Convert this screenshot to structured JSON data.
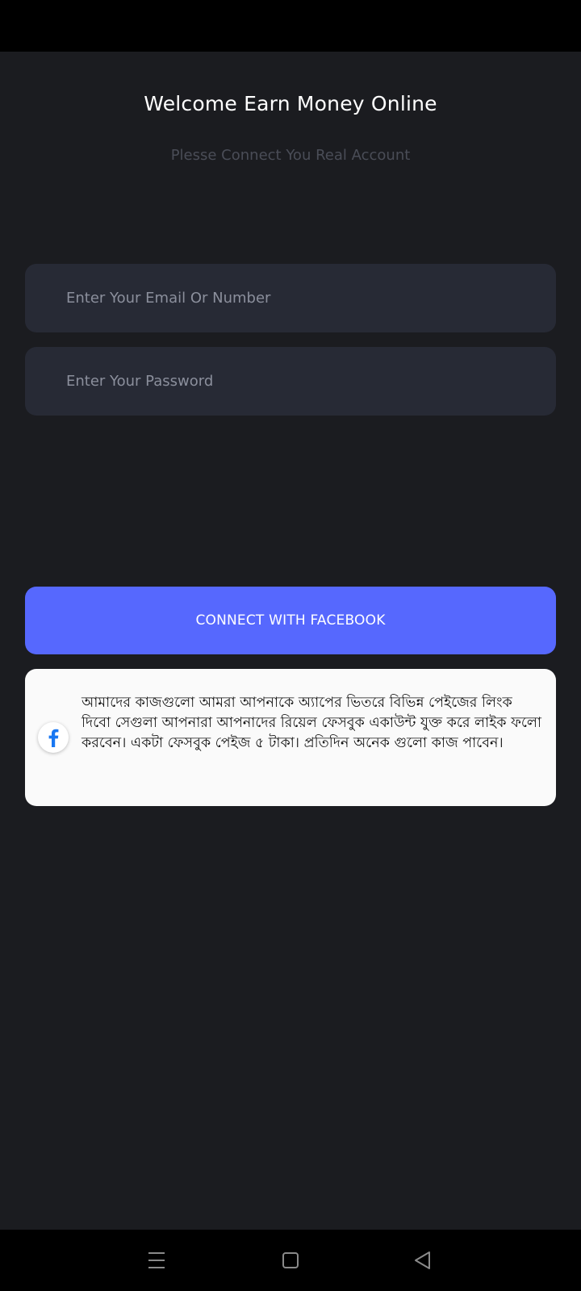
{
  "header": {
    "title": "Welcome Earn Money Online",
    "subtitle": "Plesse Connect You Real Account"
  },
  "form": {
    "email_placeholder": "Enter Your Email Or Number",
    "email_value": "",
    "password_placeholder": "Enter Your Password",
    "password_value": ""
  },
  "connect_button": {
    "label": "CONNECT WITH FACEBOOK",
    "color": "#5668fe"
  },
  "info_card": {
    "icon": "facebook-icon",
    "text": "আমাদের কাজগুলো আমরা আপনাকে অ্যাপের ভিতরে বিভিন্ন পেইজের লিংক দিবো সেগুলা আপনারা আপনাদের রিয়েল ফেসবুক একাউন্ট যুক্ত করে লাইক ফলো করবেন। একটা ফেসবুক পেইজ ৫ টাকা। প্রতিদিন অনেক গুলো কাজ পাবেন।"
  },
  "navigation_bar": {
    "icons": [
      "menu-icon",
      "home-icon",
      "back-icon"
    ]
  },
  "colors": {
    "background": "#1b1c20",
    "field": "#272a35",
    "accent": "#5668fe",
    "facebook_blue": "#1877f2"
  }
}
